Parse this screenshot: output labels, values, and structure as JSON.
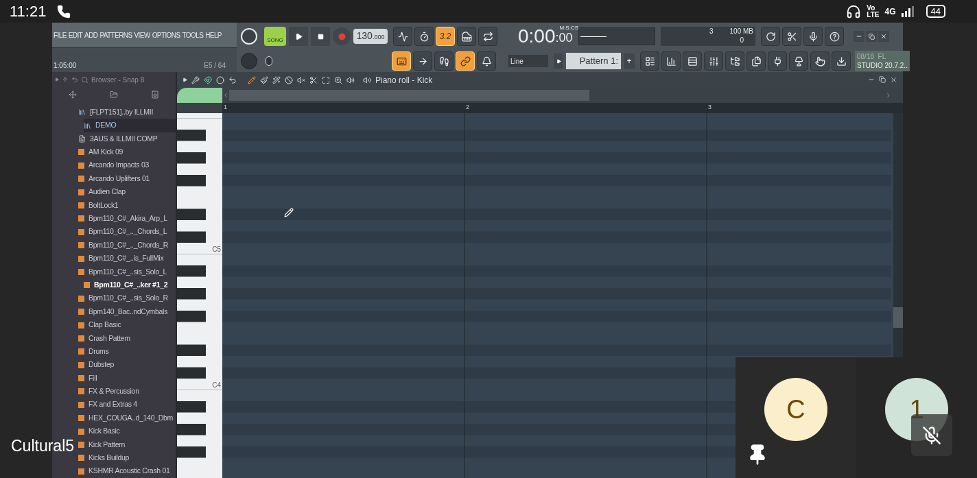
{
  "phone_status": {
    "time": "11:21",
    "volte": [
      "Vo",
      "LTE"
    ],
    "network": "4G",
    "battery": "44"
  },
  "menu": [
    "FILE",
    "EDIT",
    "ADD",
    "PATTERNS",
    "VIEW",
    "OPTIONS",
    "TOOLS",
    "HELP"
  ],
  "hint": {
    "position": "1:05:00",
    "note": "E5 / 64"
  },
  "transport": {
    "mode": "SONG",
    "song_mode": true,
    "tempo": "130",
    "tempo_fraction": ".000"
  },
  "toggles_top": [
    {
      "kind": "wave",
      "on": false
    },
    {
      "kind": "metronome",
      "on": false
    },
    {
      "kind": "countdown",
      "label": "3.2",
      "on": true
    },
    {
      "kind": "piano",
      "on": false
    },
    {
      "kind": "loop",
      "on": false
    }
  ],
  "toggles_bottom": [
    {
      "kind": "typing",
      "on": true
    },
    {
      "kind": "arrow",
      "on": false
    },
    {
      "kind": "step",
      "on": false
    },
    {
      "kind": "link",
      "on": true
    },
    {
      "kind": "bell",
      "on": false
    }
  ],
  "clock": {
    "time": "0:00",
    "centis": ":00",
    "format": "M:S:CS"
  },
  "monitor": {
    "voices": "3",
    "memory": "100 MB",
    "cpu": "0"
  },
  "snap": "Line",
  "pattern": {
    "name": "Pattern 1:",
    "add": "+"
  },
  "news": [
    "08/18  FL",
    "STUDIO 20.7.2.."
  ],
  "browser": {
    "title": "Browser - Snap 8",
    "items": [
      {
        "label": "[FLPT151]..by ILLMII",
        "kind": "project",
        "selected": false,
        "highlighted": false,
        "children": [
          {
            "label": "DEMO",
            "kind": "project",
            "selected": true,
            "highlighted": false
          }
        ]
      },
      {
        "label": "3AUS & ILLMII COMP",
        "kind": "file",
        "selected": false,
        "highlighted": false
      },
      {
        "label": "AM Kick 09",
        "kind": "pattern",
        "selected": false,
        "highlighted": false
      },
      {
        "label": "Arcando Impacts 03",
        "kind": "pattern",
        "selected": false,
        "highlighted": false
      },
      {
        "label": "Arcando Uplifters 01",
        "kind": "pattern",
        "selected": false,
        "highlighted": false
      },
      {
        "label": "Audien Clap",
        "kind": "pattern",
        "selected": false,
        "highlighted": false
      },
      {
        "label": "BoltLock1",
        "kind": "pattern",
        "selected": false,
        "highlighted": false
      },
      {
        "label": "Bpm110_C#_Akira_Arp_L",
        "kind": "pattern",
        "selected": false,
        "highlighted": false
      },
      {
        "label": "Bpm110_C#_.._Chords_L",
        "kind": "pattern",
        "selected": false,
        "highlighted": false
      },
      {
        "label": "Bpm110_C#_.._Chords_R",
        "kind": "pattern",
        "selected": false,
        "highlighted": false
      },
      {
        "label": "Bpm110_C#_..is_FullMix",
        "kind": "pattern",
        "selected": false,
        "highlighted": false
      },
      {
        "label": "Bpm110_C#_..sis_Solo_L",
        "kind": "pattern",
        "selected": false,
        "highlighted": false
      },
      {
        "label": "Bpm110_C#_..ker #1_2",
        "kind": "pattern",
        "selected": false,
        "highlighted": true
      },
      {
        "label": "Bpm110_C#_..sis_Solo_R",
        "kind": "pattern",
        "selected": false,
        "highlighted": false
      },
      {
        "label": "Bpm140_Bac..ndCymbals",
        "kind": "pattern",
        "selected": false,
        "highlighted": false
      },
      {
        "label": "Clap Basic",
        "kind": "pattern",
        "selected": false,
        "highlighted": false
      },
      {
        "label": "Crash Pattern",
        "kind": "pattern",
        "selected": false,
        "highlighted": false
      },
      {
        "label": "Drums",
        "kind": "pattern",
        "selected": false,
        "highlighted": false
      },
      {
        "label": "Dubstep",
        "kind": "pattern",
        "selected": false,
        "highlighted": false
      },
      {
        "label": "Fill",
        "kind": "pattern",
        "selected": false,
        "highlighted": false
      },
      {
        "label": "FX & Percussion",
        "kind": "pattern",
        "selected": false,
        "highlighted": false
      },
      {
        "label": "FX and Extras 4",
        "kind": "pattern",
        "selected": false,
        "highlighted": false
      },
      {
        "label": "HEX_COUGA..d_140_Dbm",
        "kind": "pattern",
        "selected": false,
        "highlighted": false
      },
      {
        "label": "Kick Basic",
        "kind": "pattern",
        "selected": false,
        "highlighted": false
      },
      {
        "label": "Kick Pattern",
        "kind": "pattern",
        "selected": false,
        "highlighted": false
      },
      {
        "label": "Kicks Buildup",
        "kind": "pattern",
        "selected": false,
        "highlighted": false
      },
      {
        "label": "KSHMR Acoustic Crash 01",
        "kind": "pattern",
        "selected": false,
        "highlighted": false
      }
    ]
  },
  "piano_roll": {
    "title": "Piano roll - Kick",
    "bars": [
      "1",
      "2",
      "3"
    ],
    "key_labels": [
      "C5",
      "C4"
    ]
  },
  "call": {
    "caller": "Cultural5",
    "participants": [
      {
        "initial": "C",
        "color": "#fbeecb",
        "pinned": true,
        "muted": false
      },
      {
        "initial": "1",
        "color": "#cfe3d8",
        "pinned": false,
        "muted": true
      }
    ]
  }
}
